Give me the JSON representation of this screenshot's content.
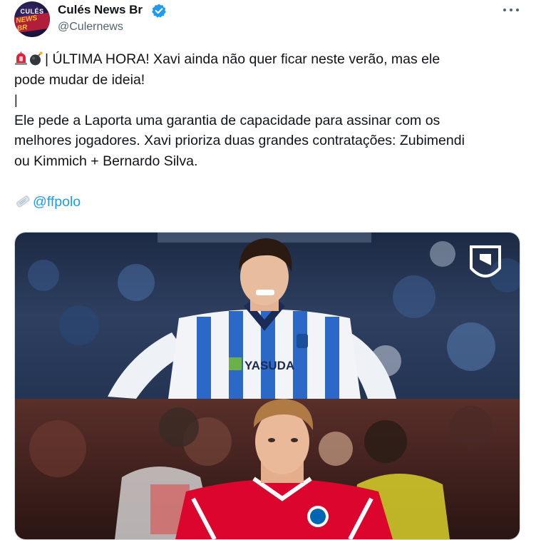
{
  "author": {
    "display_name": "Culés News Br",
    "handle": "@Culernews",
    "avatar_text_line1": "CULÉS",
    "avatar_text_line2": "NEWS BR",
    "verified": true
  },
  "tweet": {
    "line1_text": "| ÚLTIMA HORA! Xavi ainda não quer ficar neste verão, mas ele",
    "line2_text": "pode mudar de ideia!",
    "line3_text": "|",
    "line4_text": "Ele pede a Laporta uma garantia de capacidade para assinar com os",
    "line5_text": "melhores jogadores. Xavi prioriza duas grandes contratações: Zubimendi",
    "line6_text": "ou Kimmich + Bernardo Silva.",
    "source_mention": "@ffpolo",
    "emojis": [
      "rotating-light-icon",
      "bomb-icon",
      "newspaper-icon"
    ]
  },
  "media": {
    "top_kit_sponsor": "YASUDA"
  },
  "colors": {
    "accent": "#1d9bf0",
    "text": "#0f1419",
    "secondary_text": "#536471",
    "sociedad_blue": "#2b68c7",
    "bayern_red": "#dc052d"
  }
}
